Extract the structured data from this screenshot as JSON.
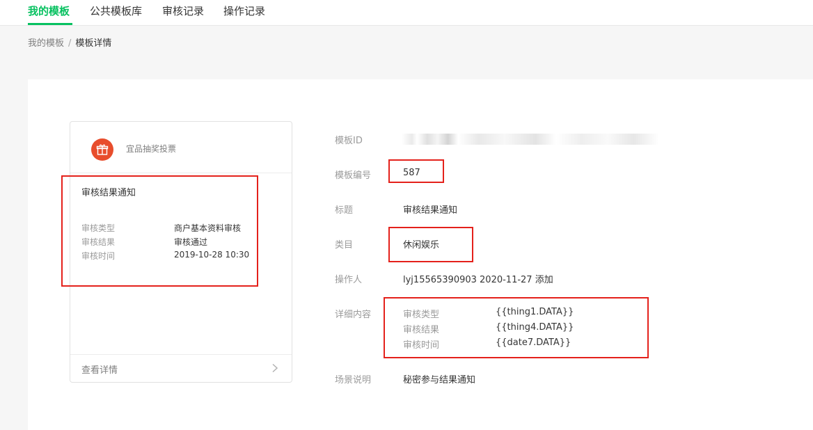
{
  "nav": {
    "tabs": [
      {
        "label": "我的模板",
        "active": true
      },
      {
        "label": "公共模板库",
        "active": false
      },
      {
        "label": "审核记录",
        "active": false
      },
      {
        "label": "操作记录",
        "active": false
      }
    ]
  },
  "breadcrumb": {
    "parent": "我的模板",
    "separator": "/",
    "current": "模板详情"
  },
  "preview": {
    "app_icon": "gift-icon",
    "app_name": "宜品抽奖投票",
    "title": "审核结果通知",
    "fields": [
      {
        "label": "审核类型",
        "value": "商户基本资料审核"
      },
      {
        "label": "审核结果",
        "value": "审核通过"
      },
      {
        "label": "审核时间",
        "value": "2019-10-28 10:30"
      }
    ],
    "footer_label": "查看详情",
    "footer_icon": "chevron-right-icon"
  },
  "details": {
    "template_id": {
      "label": "模板ID",
      "value": "（已打码）"
    },
    "template_number": {
      "label": "模板编号",
      "value": "587"
    },
    "title": {
      "label": "标题",
      "value": "审核结果通知"
    },
    "category": {
      "label": "类目",
      "value": "休闲娱乐"
    },
    "operator": {
      "label": "操作人",
      "value": "lyj15565390903 2020-11-27 添加"
    },
    "content": {
      "label": "详细内容",
      "fields": [
        {
          "label": "审核类型",
          "value": "{{thing1.DATA}}"
        },
        {
          "label": "审核结果",
          "value": "{{thing4.DATA}}"
        },
        {
          "label": "审核时间",
          "value": "{{date7.DATA}}"
        }
      ]
    },
    "scene": {
      "label": "场景说明",
      "value": "秘密参与结果通知"
    }
  },
  "colors": {
    "accent": "#07c160",
    "highlight_box": "#e4211b",
    "app_icon_bg": "#e84d2c"
  }
}
